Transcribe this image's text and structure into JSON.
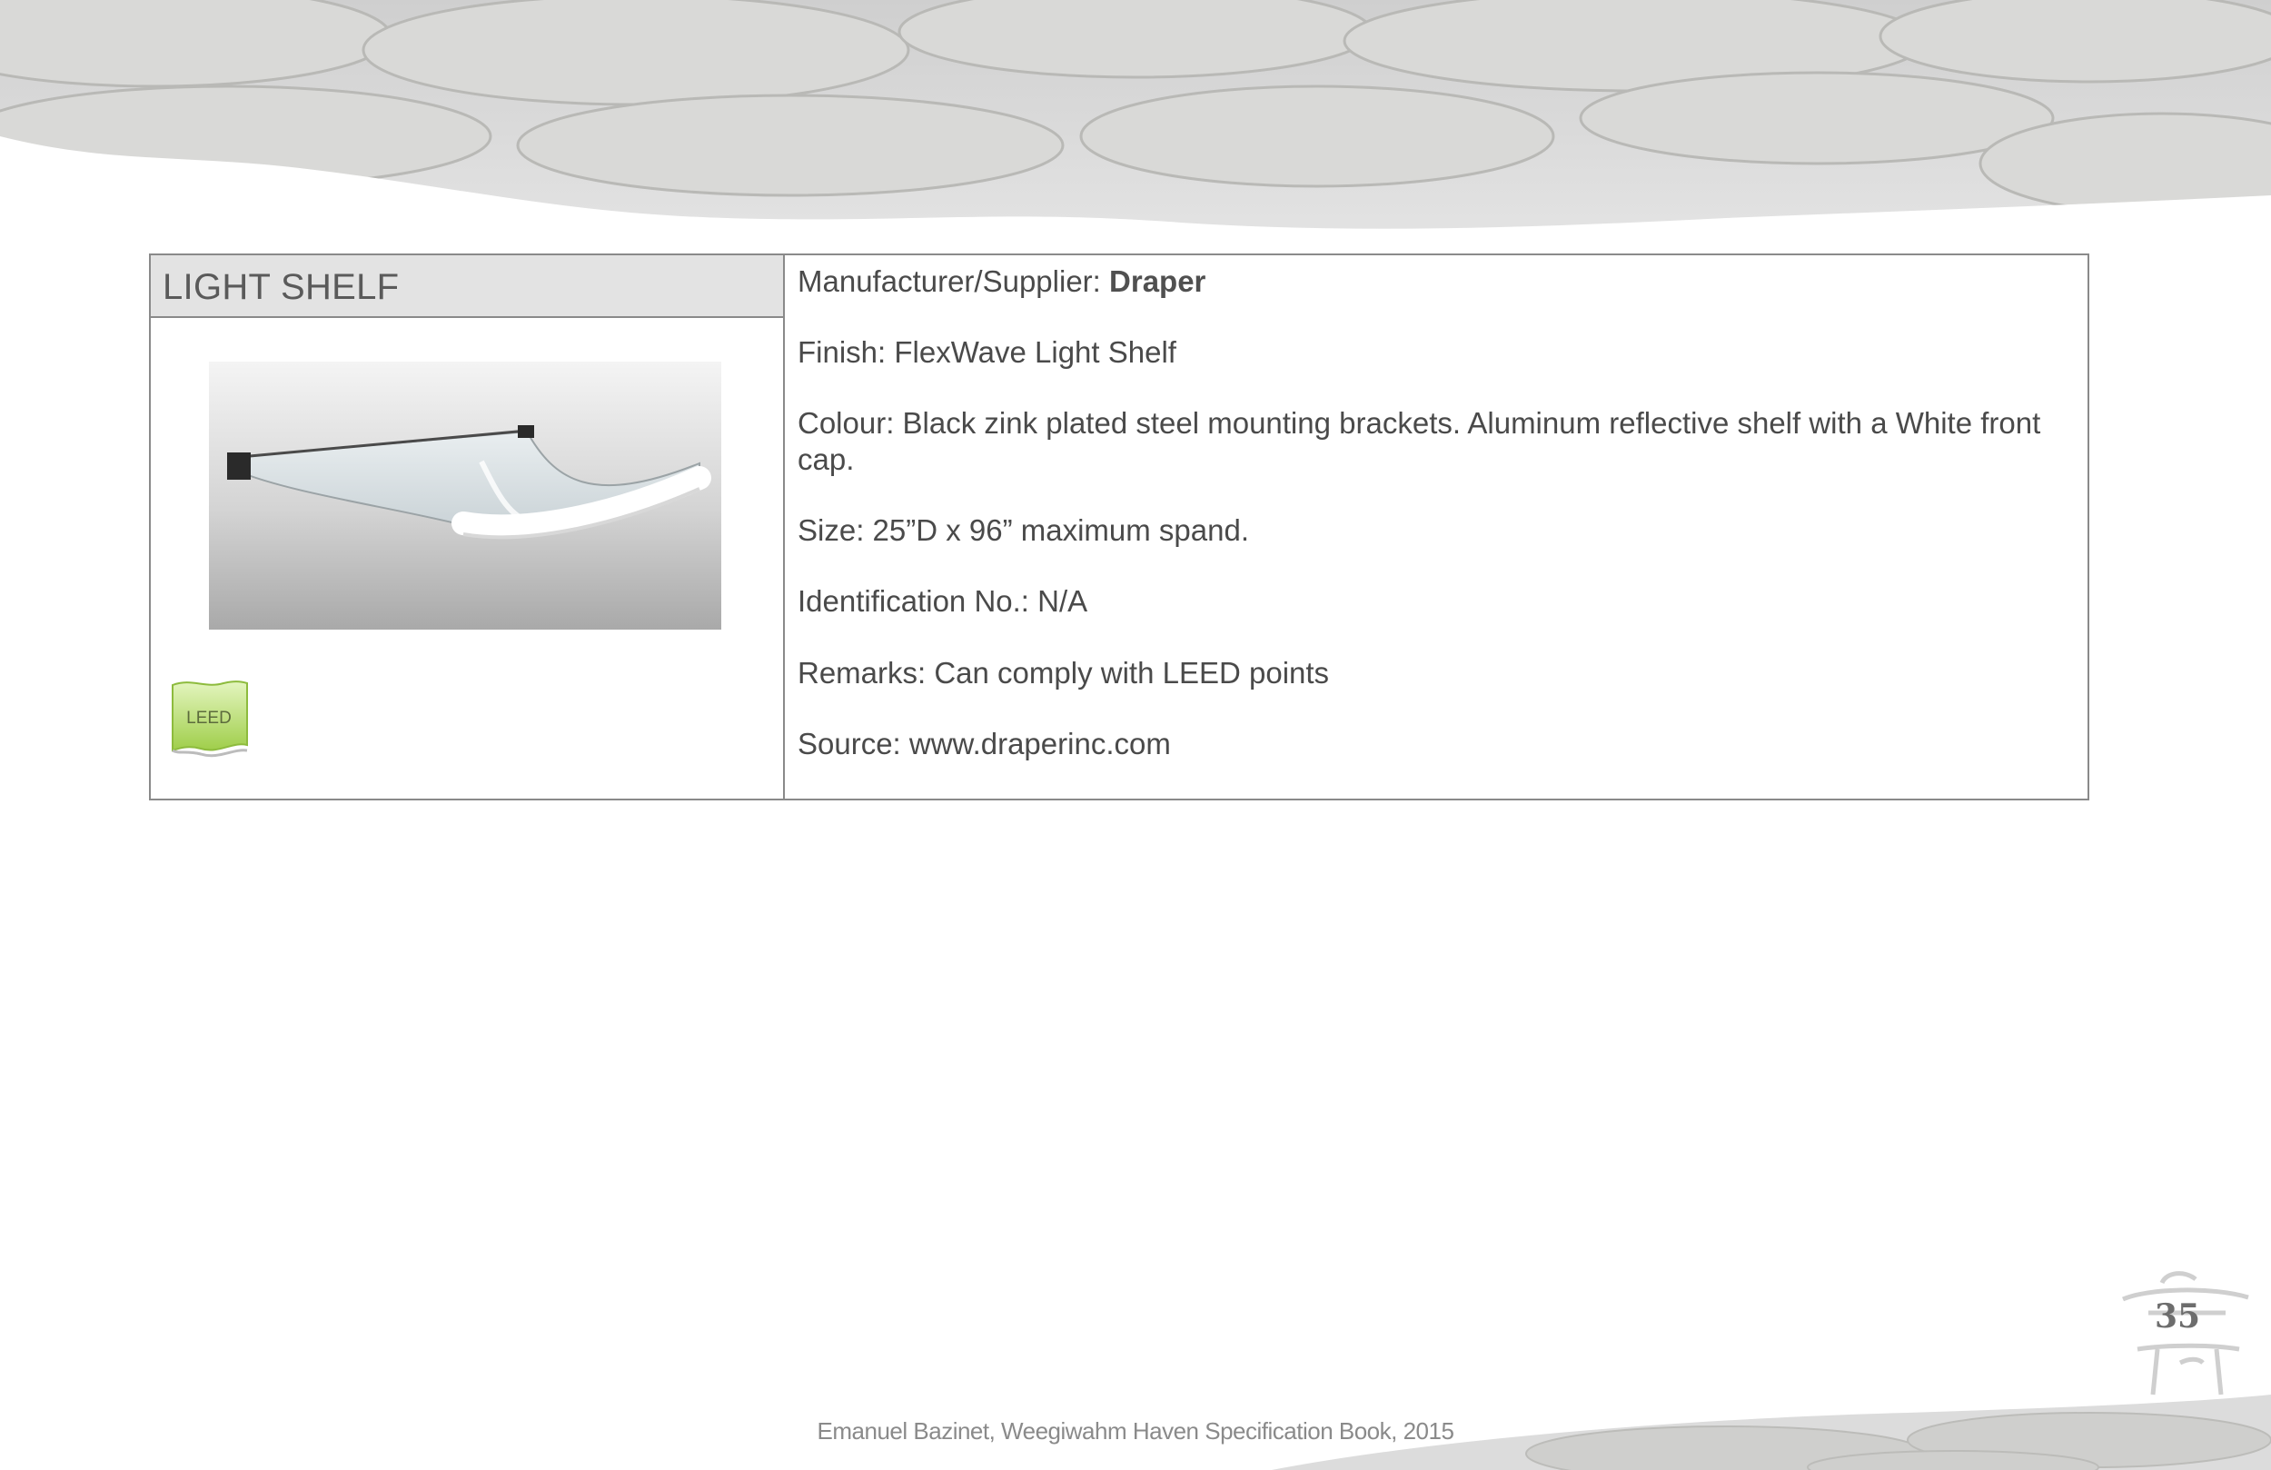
{
  "product": {
    "title": "LIGHT SHELF",
    "badge": "LEED"
  },
  "details": {
    "manufacturer_label": "Manufacturer/Supplier: ",
    "manufacturer_value": "Draper",
    "finish": "Finish: FlexWave Light Shelf",
    "colour": "Colour: Black zink plated steel mounting brackets. Aluminum reflective shelf with a White front cap.",
    "size": "Size: 25”D x 96” maximum spand.",
    "identification": "Identification No.: N/A",
    "remarks": "Remarks: Can comply with LEED points",
    "source": "Source: www.draperinc.com"
  },
  "page": {
    "number": "35",
    "footer": "Emanuel Bazinet, Weegiwahm Haven Specification Book, 2015"
  },
  "colors": {
    "border": "#8a8a8a",
    "title_bg": "#e3e3e3",
    "leed_green": "#b5dd6a"
  }
}
